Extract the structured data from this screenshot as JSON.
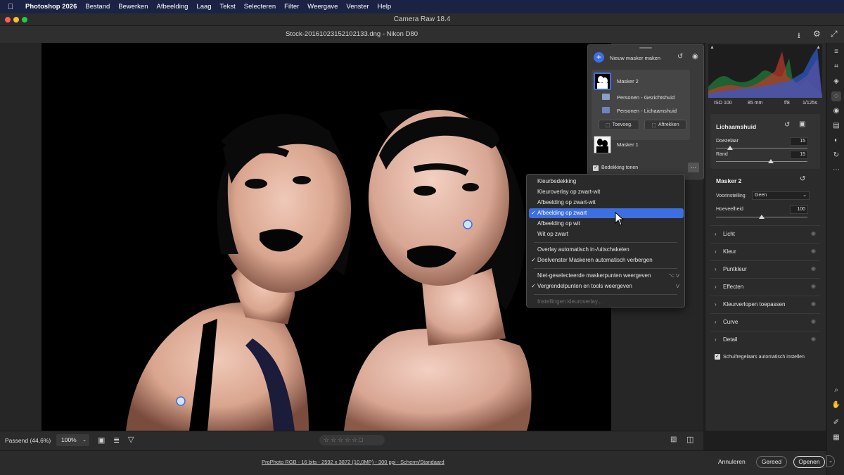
{
  "menubar": {
    "app": "Photoshop 2026",
    "items": [
      "Bestand",
      "Bewerken",
      "Afbeelding",
      "Laag",
      "Tekst",
      "Selecteren",
      "Filter",
      "Weergave",
      "Venster",
      "Help"
    ]
  },
  "window": {
    "title": "Camera Raw 18.4"
  },
  "file": {
    "name": "Stock-20161023152102133.dng  -  Nikon D80"
  },
  "mask_panel": {
    "new_mask_label": "Nieuw masker maken",
    "masks": [
      {
        "name": "Masker 2",
        "components": [
          "Personen - Gezichtshuid",
          "Personen - Lichaamshuid"
        ]
      },
      {
        "name": "Masker 1",
        "components": []
      }
    ],
    "add_label": "Toevoeg.",
    "subtract_label": "Aftrekken",
    "overlay_label": "Bedekking tonen",
    "overlay_checked": true
  },
  "context_menu": {
    "group1": [
      {
        "label": "Kleurbedekking",
        "checked": false
      },
      {
        "label": "Kleuroverlay op zwart-wit",
        "checked": false
      },
      {
        "label": "Afbeelding op zwart-wit",
        "checked": false
      },
      {
        "label": "Afbeelding op zwart",
        "checked": true,
        "selected": true
      },
      {
        "label": "Afbeelding op wit",
        "checked": false
      },
      {
        "label": "Wit op zwart",
        "checked": false
      }
    ],
    "group2": [
      {
        "label": "Overlay automatisch in-/uitschakelen",
        "checked": false
      },
      {
        "label": "Deelvenster Maskeren automatisch verbergen",
        "checked": true
      }
    ],
    "group3": [
      {
        "label": "Niet-geselecteerde maskerpunten weergeven",
        "checked": false,
        "shortcut": "⌥ V"
      },
      {
        "label": "Vergrendelpunten en tools weergeven",
        "checked": true,
        "shortcut": "V"
      }
    ],
    "disabled_item": "Instellingen kleuroverlay..."
  },
  "exif": {
    "iso": "ISO 100",
    "focal": "85 mm",
    "aperture": "f/8",
    "shutter": "1/125s"
  },
  "lichaamshuid": {
    "title": "Lichaamshuid",
    "doezelaar_label": "Doezelaar",
    "doezelaar_value": "15",
    "doezelaar_level": 0.15,
    "rand_label": "Rand",
    "rand_value": "15",
    "rand_level": 0.6
  },
  "masker2": {
    "title": "Masker 2",
    "preset_label": "Voorinstelling",
    "preset_value": "Geen",
    "amount_label": "Hoeveelheid",
    "amount_value": "100",
    "amount_level": 0.5
  },
  "sections": [
    "Licht",
    "Kleur",
    "Puntkleur",
    "Effecten",
    "Kleurverlopen toepassen",
    "Curve",
    "Detail"
  ],
  "auto_sliders_label": "Schuifregelaars automatisch instellen",
  "bottombar": {
    "zoom_fit": "Passend (44,6%)",
    "zoom_100": "100%"
  },
  "footer": {
    "info": "ProPhoto RGB - 16 bits - 2592 x 3872 (10,0MP) - 300 ppi - Scherm/Standaard",
    "cancel": "Annuleren",
    "done": "Gereed",
    "open": "Openen"
  },
  "colors": {
    "accent": "#3d6fe0",
    "panel": "#2b2b2b",
    "menubar": "#1a2344"
  }
}
